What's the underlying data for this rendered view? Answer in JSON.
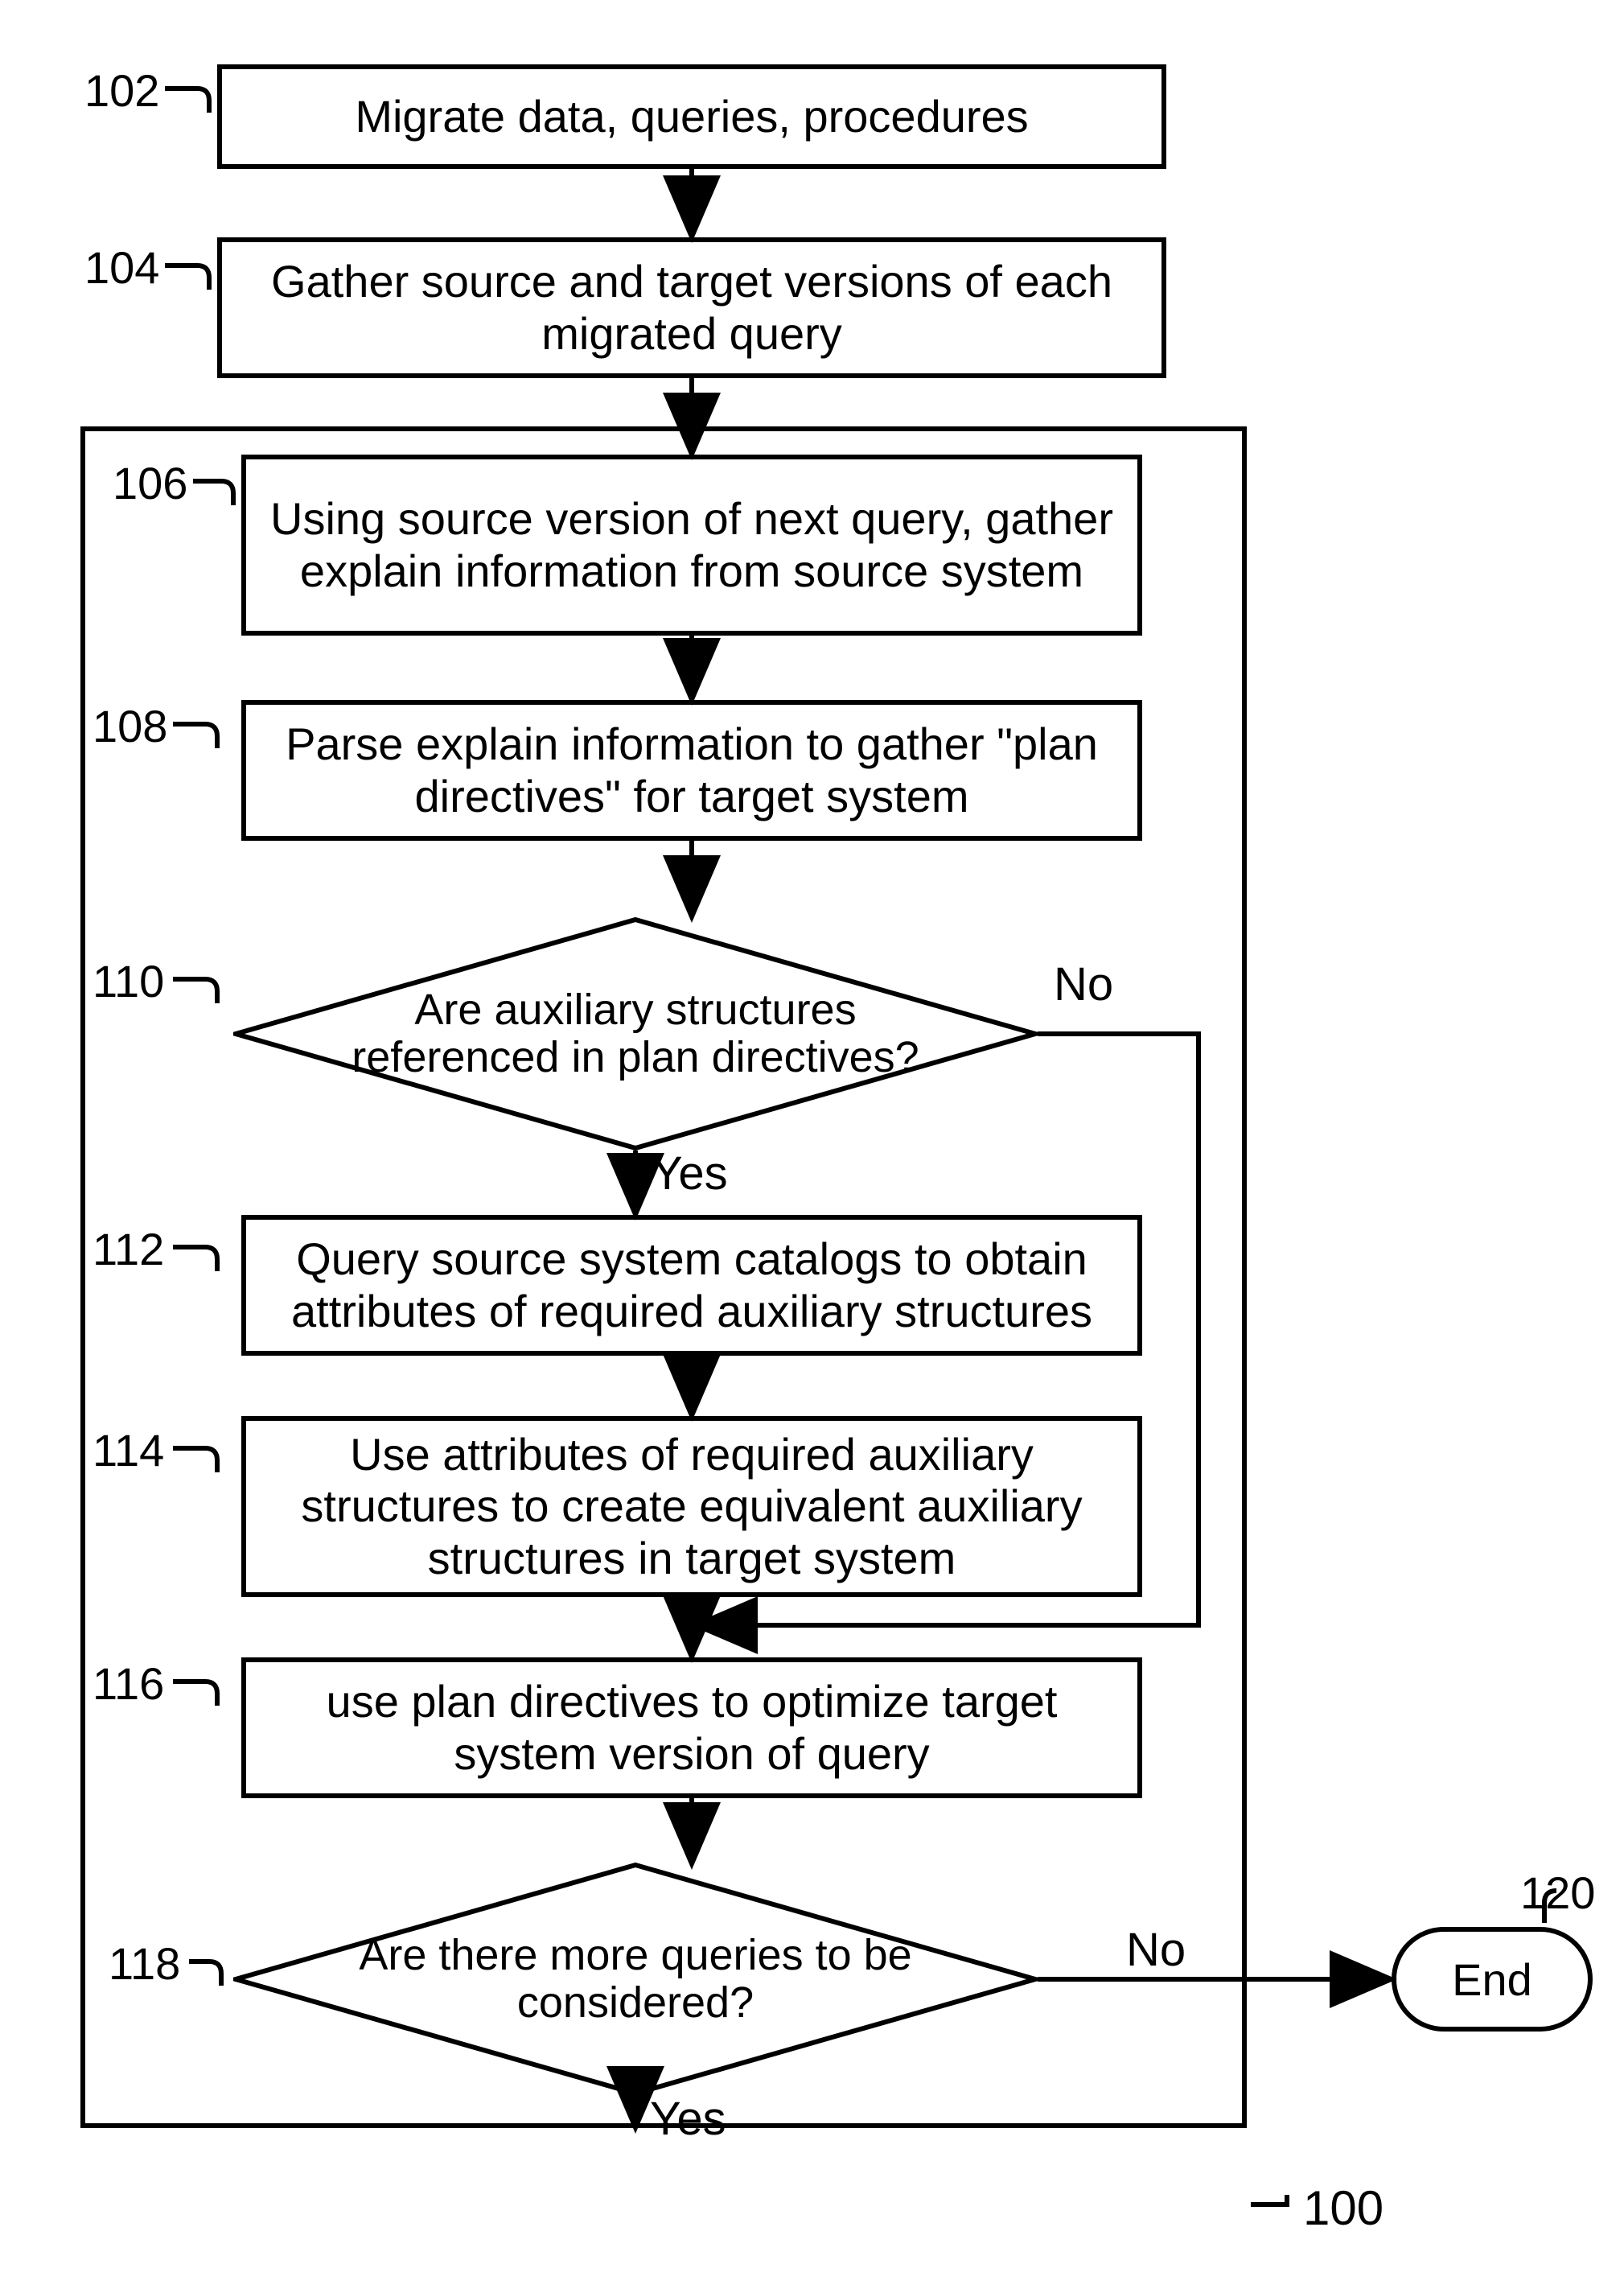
{
  "figure_number": "100",
  "nodes": {
    "n102": {
      "ref": "102",
      "text": "Migrate data, queries, procedures"
    },
    "n104": {
      "ref": "104",
      "text": "Gather source and target versions of each migrated query"
    },
    "n106": {
      "ref": "106",
      "text": "Using source version of next query, gather explain information from source system"
    },
    "n108": {
      "ref": "108",
      "text": "Parse explain information to gather \"plan directives\" for target system"
    },
    "n110": {
      "ref": "110",
      "text": "Are auxiliary structures referenced in plan directives?"
    },
    "n112": {
      "ref": "112",
      "text": "Query source system catalogs to obtain attributes of required auxiliary structures"
    },
    "n114": {
      "ref": "114",
      "text": "Use attributes of required auxiliary structures to create equivalent auxiliary structures in target system"
    },
    "n116": {
      "ref": "116",
      "text": "use plan directives to optimize target system version of query"
    },
    "n118": {
      "ref": "118",
      "text": "Are there more queries to be considered?"
    },
    "n120": {
      "ref": "120",
      "text": "End"
    }
  },
  "edges": {
    "n110_yes": "Yes",
    "n110_no": "No",
    "n118_yes": "Yes",
    "n118_no": "No"
  }
}
